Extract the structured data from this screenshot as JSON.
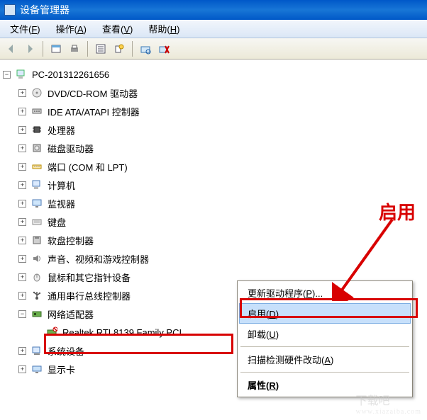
{
  "titlebar": {
    "title": "设备管理器"
  },
  "menubar": {
    "file": "文件(",
    "file_u": "F",
    "file_end": ")",
    "action": "操作(",
    "action_u": "A",
    "action_end": ")",
    "view": "查看(",
    "view_u": "V",
    "view_end": ")",
    "help": "帮助(",
    "help_u": "H",
    "help_end": ")"
  },
  "tree": {
    "root": "PC-201312261656",
    "items": [
      {
        "label": "DVD/CD-ROM 驱动器",
        "icon": "cd"
      },
      {
        "label": "IDE ATA/ATAPI 控制器",
        "icon": "ide"
      },
      {
        "label": "处理器",
        "icon": "cpu"
      },
      {
        "label": "磁盘驱动器",
        "icon": "disk"
      },
      {
        "label": "端口 (COM 和 LPT)",
        "icon": "port"
      },
      {
        "label": "计算机",
        "icon": "computer"
      },
      {
        "label": "监视器",
        "icon": "monitor"
      },
      {
        "label": "键盘",
        "icon": "keyboard"
      },
      {
        "label": "软盘控制器",
        "icon": "floppy"
      },
      {
        "label": "声音、视频和游戏控制器",
        "icon": "sound"
      },
      {
        "label": "鼠标和其它指针设备",
        "icon": "mouse"
      },
      {
        "label": "通用串行总线控制器",
        "icon": "usb"
      },
      {
        "label": "网络适配器",
        "icon": "net",
        "expanded": true
      },
      {
        "label": "系统设备",
        "icon": "system"
      },
      {
        "label": "显示卡",
        "icon": "display"
      }
    ],
    "net_child": "Realtek RTL8139 Family PCI"
  },
  "context_menu": {
    "update": "更新驱动程序(",
    "update_u": "P",
    "update_end": ")...",
    "enable": "启用(",
    "enable_u": "D",
    "enable_end": ")",
    "uninstall": "卸载(",
    "uninstall_u": "U",
    "uninstall_end": ")",
    "scan": "扫描检测硬件改动(",
    "scan_u": "A",
    "scan_end": ")",
    "props": "属性(",
    "props_u": "R",
    "props_end": ")"
  },
  "callout": {
    "text": "启用"
  },
  "watermark": {
    "big": "下载吧",
    "small": "www.xiazaiba.com"
  }
}
